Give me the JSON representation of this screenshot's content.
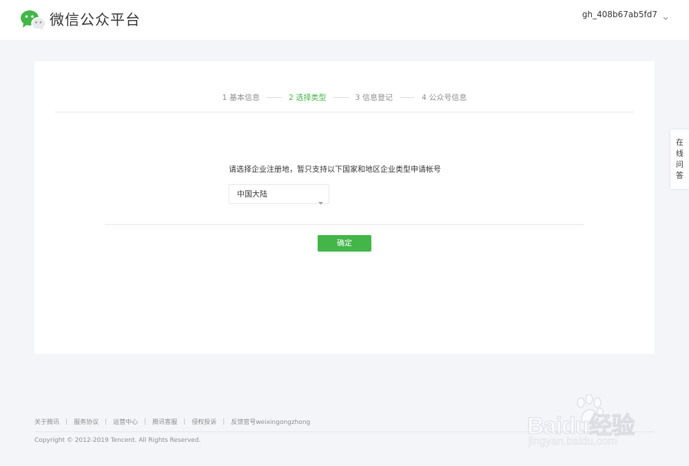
{
  "header": {
    "logo_icon": "wechat-logo-icon",
    "title": "微信公众平台",
    "account_name": "gh_408b67ab5fd7",
    "account_caret_icon": "caret-down-icon"
  },
  "steps": [
    {
      "label": "1 基本信息",
      "state": "done"
    },
    {
      "label": "2 选择类型",
      "state": "active"
    },
    {
      "label": "3 信息登记",
      "state": "todo"
    },
    {
      "label": "4 公众号信息",
      "state": "todo"
    }
  ],
  "form": {
    "question": "请选择企业注册地，暂只支持以下国家和地区企业类型申请帐号",
    "region_selected": "中国大陆",
    "select_arrow_icon": "dropdown-arrow-icon",
    "confirm_label": "确定"
  },
  "side_tab": {
    "chars": [
      "在",
      "线",
      "问",
      "答"
    ]
  },
  "footer": {
    "links": [
      "关于腾讯",
      "服务协议",
      "运营中心",
      "腾讯客服",
      "侵权投诉",
      "反馈官号weixingongzhong"
    ],
    "separator": "|",
    "copyright": "Copyright © 2012-2019 Tencent. All Rights Reserved."
  },
  "watermark": {
    "brand": "Baidu经验",
    "url": "jingyan.baidu.com",
    "icon": "baidu-paw-icon"
  },
  "colors": {
    "accent": "#44b549",
    "page_bg": "#f4f5f9",
    "text": "#353535",
    "muted": "#8d8d8d",
    "border": "#e7e7eb"
  }
}
